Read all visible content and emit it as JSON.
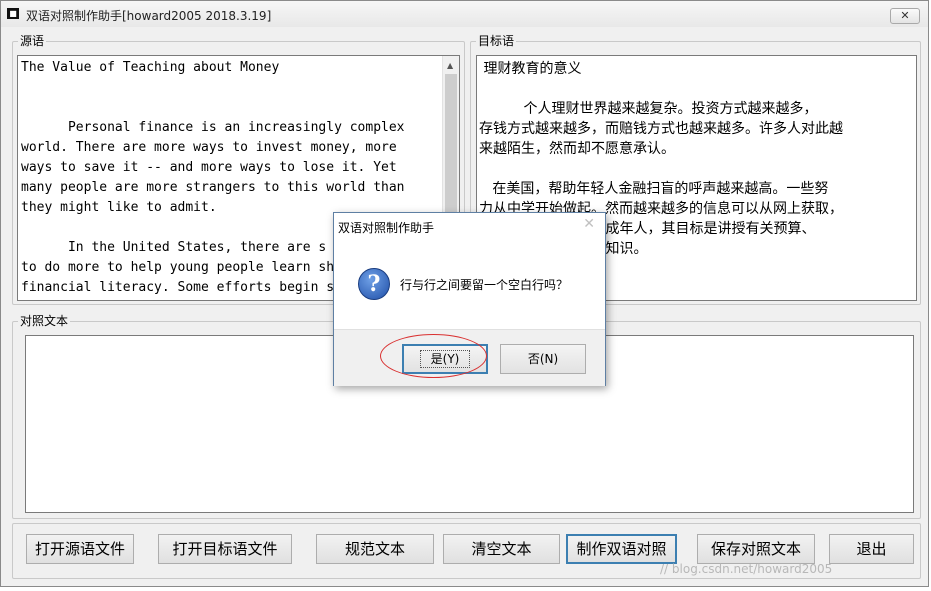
{
  "window": {
    "title": "双语对照制作助手[howard2005 2018.3.19]",
    "close_label": "✕"
  },
  "source": {
    "label": "源语",
    "text": "The Value of Teaching about Money\n\n\n      Personal finance is an increasingly complex\nworld. There are more ways to invest money, more\nways to save it -- and more ways to lose it. Yet\nmany people are more strangers to this world than\nthey might like to admit.\n\n      In the United States, there are s\nto do more to help young people learn sh\nfinancial literacy. Some efforts begin s"
  },
  "target": {
    "label": "目标语",
    "text": " 理财教育的意义\n\n          个人理财世界越来越复杂。投资方式越来越多，\n存钱方式越来越多，而赔钱方式也越来越多。许多人对此越\n来越陌生，然而却不愿意承认。\n\n   在美国，帮助年轻人金融扫盲的呼声越来越高。一些努\n力从中学开始做起。然而越来越多的信息可以从网上获取，\n                   也针对成年人，其目标是讲授有关预算、\n                   方面的知识。"
  },
  "parallel": {
    "label": "对照文本",
    "text": ""
  },
  "buttons": {
    "open_source": "打开源语文件",
    "open_target": "打开目标语文件",
    "normalize": "规范文本",
    "clear": "清空文本",
    "make_bilingual": "制作双语对照",
    "save": "保存对照文本",
    "exit": "退出"
  },
  "watermark": "// blog.csdn.net/howard2005",
  "dialog": {
    "title": "双语对照制作助手",
    "close_label": "✕",
    "icon": "question-icon",
    "icon_glyph": "?",
    "message": "行与行之间要留一个空白行吗？",
    "yes_label": "是(Y)",
    "no_label": "否(N)"
  },
  "colors": {
    "highlight_ellipse": "#d93030",
    "default_button_border": "#3c7fb1"
  }
}
